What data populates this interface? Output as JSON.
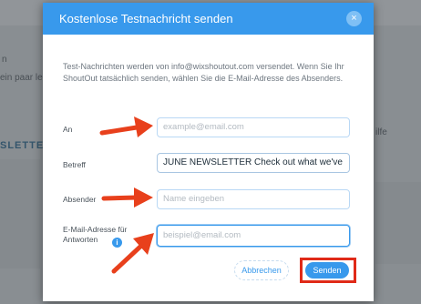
{
  "background": {
    "text_left": "ein paar le",
    "text_right_top": "n",
    "text_right_mid": "ilfe",
    "newsletter_fragment": "SLETTER"
  },
  "dialog": {
    "title": "Kostenlose Testnachricht senden",
    "close_symbol": "×",
    "intro": "Test-Nachrichten werden von info@wixshoutout.com versendet. Wenn Sie Ihr ShoutOut tatsächlich senden, wählen Sie die E-Mail-Adresse des Absenders.",
    "fields": {
      "to": {
        "label": "An",
        "placeholder": "example@email.com",
        "value": ""
      },
      "subject": {
        "label": "Betreff",
        "value": "JUNE NEWSLETTER  Check out what we've"
      },
      "sender": {
        "label": "Absender",
        "placeholder": "Name eingeben",
        "value": ""
      },
      "reply_to": {
        "label": "E-Mail-Adresse für Antworten",
        "placeholder": "beispiel@email.com",
        "value": ""
      }
    },
    "info_symbol": "i",
    "buttons": {
      "cancel": "Abbrechen",
      "send": "Senden"
    }
  },
  "colors": {
    "accent": "#3899ec",
    "highlight": "#e02a18",
    "annotation_arrow": "#e8401c"
  },
  "icons": {
    "close": "close-icon",
    "info": "info-icon",
    "annotation": "arrow-annotation"
  }
}
